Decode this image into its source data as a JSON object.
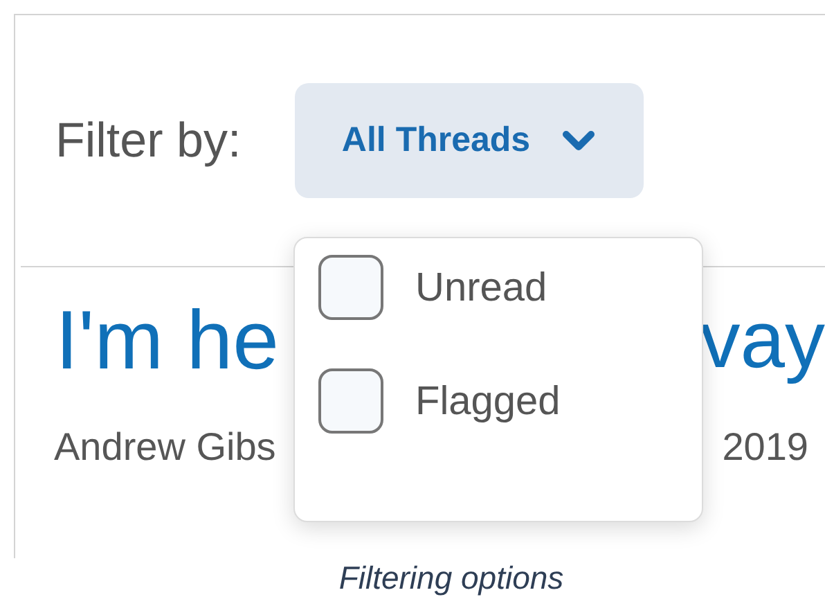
{
  "filter": {
    "label": "Filter by:",
    "dropdown": {
      "value": "All Threads",
      "expanded": true
    }
  },
  "thread": {
    "title_visible_left": "I'm he",
    "title_visible_right": "vay",
    "author_visible": "Andrew Gibs",
    "date_visible": "2019"
  },
  "menu_options": [
    {
      "label": "Unread",
      "checked": false
    },
    {
      "label": "Flagged",
      "checked": false
    }
  ],
  "caption": "Filtering options"
}
